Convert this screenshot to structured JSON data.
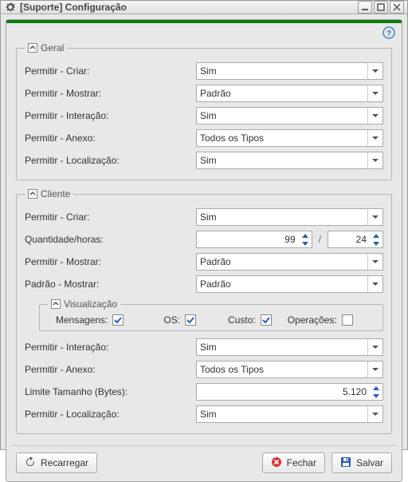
{
  "window": {
    "title": "[Suporte] Configuração"
  },
  "groups": {
    "geral": {
      "legend": "Geral",
      "permitir_criar_label": "Permitir - Criar:",
      "permitir_criar_value": "Sim",
      "permitir_mostrar_label": "Permitir - Mostrar:",
      "permitir_mostrar_value": "Padrão",
      "permitir_interacao_label": "Permitir - Interação:",
      "permitir_interacao_value": "Sim",
      "permitir_anexo_label": "Permitir - Anexo:",
      "permitir_anexo_value": "Todos os Tipos",
      "permitir_localizacao_label": "Permitir - Localização:",
      "permitir_localizacao_value": "Sim"
    },
    "cliente": {
      "legend": "Cliente",
      "permitir_criar_label": "Permitir - Criar:",
      "permitir_criar_value": "Sim",
      "quantidade_label": "Quantidade/horas:",
      "quantidade_value": "99",
      "horas_value": "24",
      "separator": "/",
      "permitir_mostrar_label": "Permitir - Mostrar:",
      "permitir_mostrar_value": "Padrão",
      "padrao_mostrar_label": "Padrão - Mostrar:",
      "padrao_mostrar_value": "Padrão",
      "viz": {
        "legend": "Visualização",
        "mensagens_label": "Mensagens:",
        "mensagens_checked": true,
        "os_label": "OS:",
        "os_checked": true,
        "custo_label": "Custo:",
        "custo_checked": true,
        "operacoes_label": "Operações:",
        "operacoes_checked": false
      },
      "permitir_interacao_label": "Permitir - Interação:",
      "permitir_interacao_value": "Sim",
      "permitir_anexo_label": "Permitir - Anexo:",
      "permitir_anexo_value": "Todos os Tipos",
      "limite_tamanho_label": "Limite Tamanho (Bytes):",
      "limite_tamanho_value": "5.120",
      "permitir_localizacao_label": "Permitir - Localização:",
      "permitir_localizacao_value": "Sim"
    }
  },
  "footer": {
    "reload_label": "Recarregar",
    "close_label": "Fechar",
    "save_label": "Salvar"
  }
}
